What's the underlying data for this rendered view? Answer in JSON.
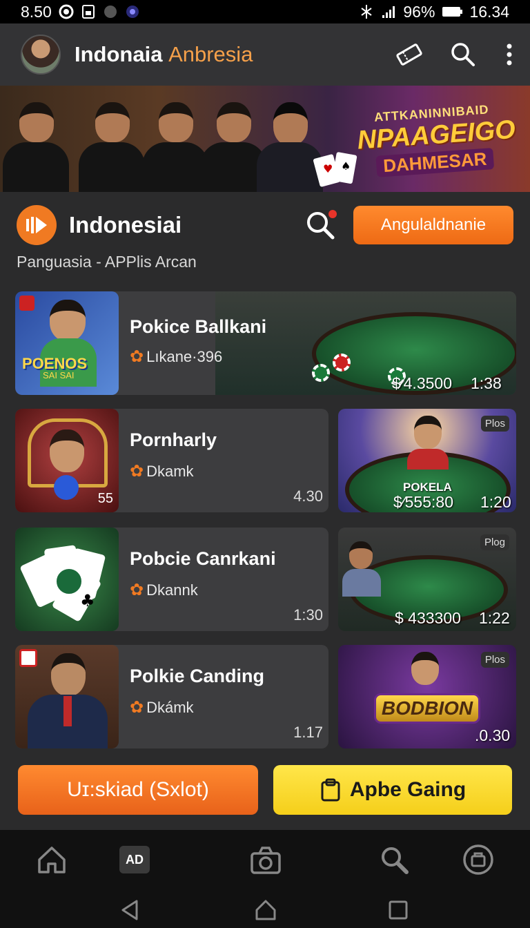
{
  "status_bar": {
    "time": "8.50",
    "battery": "96%",
    "clock": "16.34"
  },
  "app_bar": {
    "title_main": "Indonaia",
    "title_accent": "Anbresia"
  },
  "banner": {
    "line1": "ATTKANINNIBAID",
    "line2": "NPAAGEIGO",
    "line3": "DAHMESAR"
  },
  "section": {
    "title": "Indonesiai",
    "action_label": "Angulaldnanie",
    "subtitle": "Panguasia - APPlis Arcan"
  },
  "cards": [
    {
      "title": "Pokice Ballkani",
      "meta": "Lıkane·396",
      "price": "$⁄4.3500",
      "time": "1:38",
      "thumb_text": "POENOS",
      "thumb_sub": "SAI SAI"
    },
    {
      "title": "Pornharly",
      "meta": "Dkamk",
      "time": "4.30",
      "thumb_badge": "55"
    },
    {
      "title": "Pobcie Canrkani",
      "meta": "Dkannk",
      "time": "1:30"
    },
    {
      "title": "Polkie Canding",
      "meta": "Dkámk",
      "time": "1.17"
    }
  ],
  "side_tiles": [
    {
      "label": "POKELA",
      "price": "$⁄555:80",
      "time": "1:20",
      "tag": "Plos"
    },
    {
      "price": "$ 433300",
      "time": "1:22",
      "tag": "Plog"
    },
    {
      "label": "BODBION",
      "price": ".0.30",
      "tag": "Plos"
    }
  ],
  "cta": {
    "left_label": "Uɪ:skiad (Sxlot)",
    "right_label": "Apbe Gaing"
  },
  "bottom_nav": {
    "ad_label": "AD"
  },
  "colors": {
    "accent": "#f07a22",
    "yellow": "#f5cf1a",
    "background": "#2b2b2c"
  }
}
